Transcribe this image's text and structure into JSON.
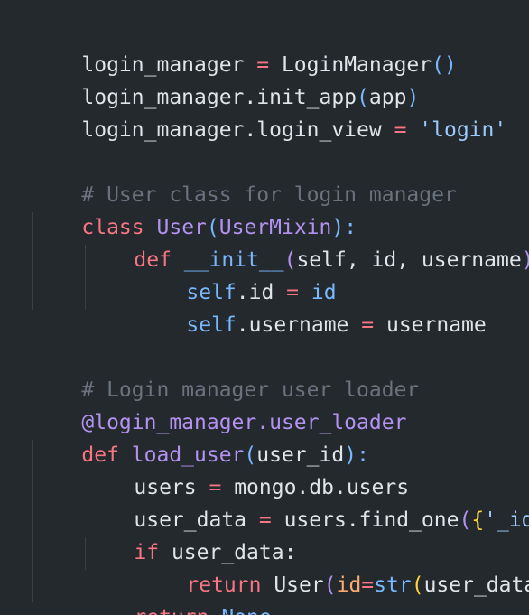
{
  "code": {
    "l1": [
      "login_manager",
      " = ",
      "LoginManager",
      "()"
    ],
    "l2": [
      "login_manager.init_app",
      "(",
      "app",
      ")"
    ],
    "l3": [
      "login_manager.login_view",
      " = ",
      "'login'"
    ],
    "l5": [
      "# User class for login manager"
    ],
    "l6": [
      "class",
      " ",
      "User",
      "(",
      "UserMixin",
      "):"
    ],
    "l7": [
      "def",
      " ",
      "__init__",
      "(",
      "self, id, username",
      "):"
    ],
    "l8": [
      "self",
      ".id ",
      "=",
      " ",
      "id"
    ],
    "l9": [
      "self",
      ".username ",
      "=",
      " username"
    ],
    "l11": [
      "# Login manager user loader"
    ],
    "l12": [
      "@login_manager.user_loader"
    ],
    "l13": [
      "def",
      " ",
      "load_user",
      "(",
      "user_id",
      "):"
    ],
    "l14": [
      "users ",
      "=",
      " mongo.db.users"
    ],
    "l15": [
      "user_data ",
      "=",
      " users.find_one",
      "(",
      "{",
      "'_id'",
      ":"
    ],
    "l16": [
      "if",
      " user_data:"
    ],
    "l17": [
      "return",
      " User",
      "(",
      "id",
      "=",
      "str",
      "(",
      "user_data",
      "[",
      "'_"
    ],
    "l18": [
      "return",
      " ",
      "None"
    ]
  },
  "colors": {
    "background": "#24292e",
    "text": "#e1e4e8",
    "keyword": "#f97583",
    "function": "#b392f0",
    "string": "#9ecbff",
    "constant": "#79b8ff",
    "comment": "#6a737d",
    "parameter": "#ffab70"
  }
}
